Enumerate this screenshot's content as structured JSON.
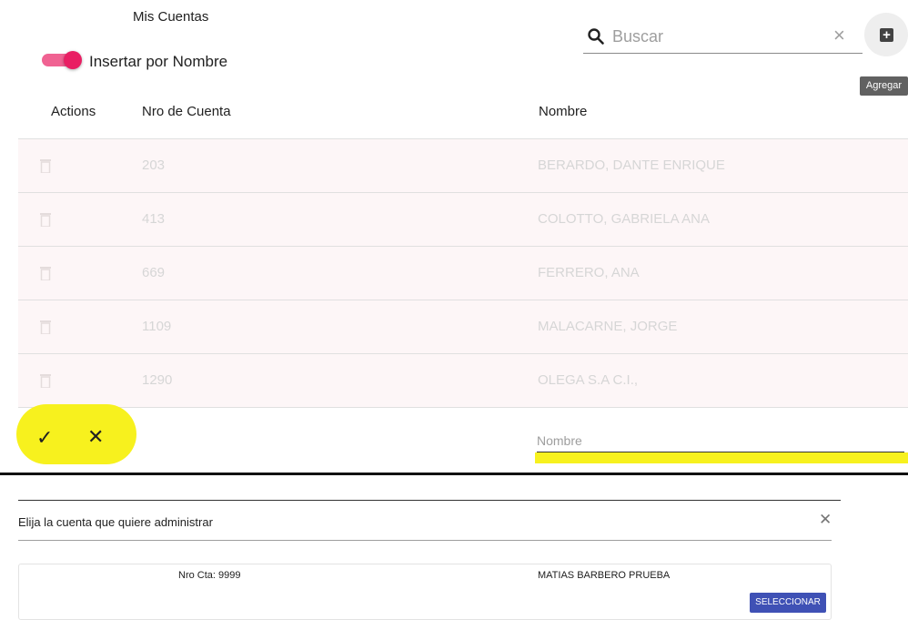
{
  "header": {
    "title": "Mis Cuentas"
  },
  "toggle": {
    "label": "Insertar por Nombre",
    "checked": true
  },
  "search": {
    "placeholder": "Buscar",
    "icon": "search-icon",
    "clear_icon": "close-icon"
  },
  "add_button": {
    "icon": "add-box-icon",
    "tooltip": "Agregar"
  },
  "table": {
    "columns": [
      "Actions",
      "Nro de Cuenta",
      "Nombre"
    ],
    "rows": [
      {
        "nro": "203",
        "nombre": "BERARDO, DANTE ENRIQUE"
      },
      {
        "nro": "413",
        "nombre": "COLOTTO, GABRIELA ANA"
      },
      {
        "nro": "669",
        "nombre": "FERRERO, ANA"
      },
      {
        "nro": "1109",
        "nombre": "MALACARNE, JORGE"
      },
      {
        "nro": "1290",
        "nombre": "OLEGA S.A C.I.,"
      }
    ],
    "new_row": {
      "confirm_icon": "check-icon",
      "cancel_icon": "close-icon",
      "nombre_placeholder": "Nombre"
    }
  },
  "modal": {
    "title": "Elija la cuenta que quiere administrar",
    "close_icon": "close-icon",
    "card": {
      "nro": "Nro Cta: 9999",
      "nombre": "MATIAS BARBERO PRUEBA",
      "button": "SELECCIONAR"
    }
  },
  "colors": {
    "accent": "#e91e63",
    "highlight": "#f7f11e",
    "primary_button": "#3f51b5"
  }
}
